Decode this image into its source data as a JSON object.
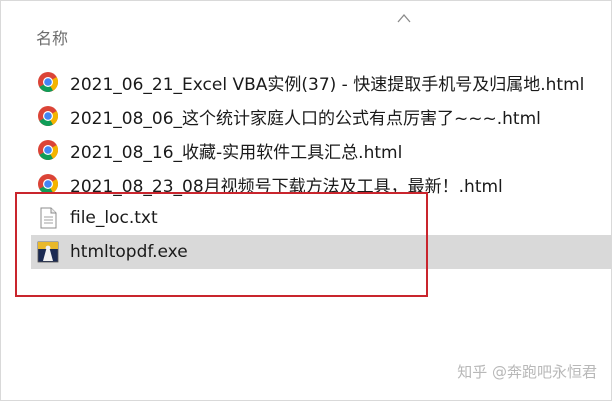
{
  "column_header": "名称",
  "sort_indicator_icon": "chevron-up-icon",
  "files": [
    {
      "name": "2021_06_21_Excel VBA实例(37) - 快速提取手机号及归属地.html",
      "icon": "chrome-icon",
      "selected": false
    },
    {
      "name": "2021_08_06_这个统计家庭人口的公式有点厉害了~~~.html",
      "icon": "chrome-icon",
      "selected": false
    },
    {
      "name": "2021_08_16_收藏-实用软件工具汇总.html",
      "icon": "chrome-icon",
      "selected": false
    },
    {
      "name": "2021_08_23_08月视频号下载方法及工具，最新！.html",
      "icon": "chrome-icon",
      "selected": false
    },
    {
      "name": "file_loc.txt",
      "icon": "text-file-icon",
      "selected": false
    },
    {
      "name": "htmltopdf.exe",
      "icon": "exe-app-icon",
      "selected": true
    }
  ],
  "annotation_color": "#c9252d",
  "selection_color": "#d9d9d9",
  "watermark": "知乎 @奔跑吧永恒君"
}
